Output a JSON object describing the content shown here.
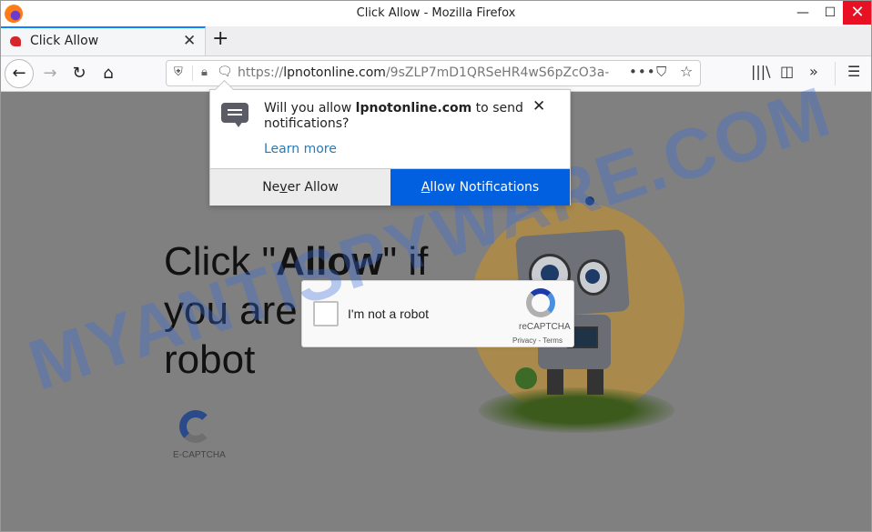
{
  "window": {
    "title": "Click Allow - Mozilla Firefox",
    "controls": {
      "minimize": "—",
      "maximize": "☐",
      "close": "✕"
    }
  },
  "tabs": [
    {
      "label": "Click Allow",
      "close": "✕",
      "active": true
    }
  ],
  "new_tab_label": "+",
  "navbar": {
    "back": "←",
    "forward": "→",
    "reload": "↻",
    "home": "⌂",
    "url_prefix": "https://",
    "url_domain": "lpnotonline.com",
    "url_path": "/9sZLP7mD1QRSeHR4wS6pZcO3a-",
    "page_actions": "•••",
    "pocket": "⛉",
    "bookmark": "☆",
    "library": "|||\\",
    "sidebar": "◫",
    "overflow": "»",
    "menu": "☰"
  },
  "notification_popup": {
    "msg_prefix": "Will you allow ",
    "msg_domain": "lpnotonline.com",
    "msg_suffix": " to send notifications?",
    "learn_more": "Learn more",
    "never_allow": {
      "before": "Ne",
      "accel": "v",
      "after": "er Allow"
    },
    "allow": {
      "accel": "A",
      "after": "llow Notifications"
    },
    "close": "✕",
    "accent_color": "#0060df"
  },
  "page": {
    "headline_1": "Click \"",
    "headline_bold": "Allow",
    "headline_2": "\" if",
    "headline_3": "you are not a",
    "headline_4": "robot",
    "ecaptcha_label": "E-CAPTCHA",
    "recaptcha": {
      "checkbox_label": "I'm not a robot",
      "brand": "reCAPTCHA",
      "links": "Privacy - Terms",
      "checked": false
    },
    "watermark": "MYANTISPYWARE.COM"
  }
}
